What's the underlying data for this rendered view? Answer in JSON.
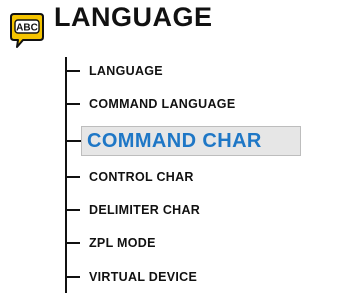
{
  "header": {
    "title": "LANGUAGE",
    "icon": "abc-speech-bubble-icon",
    "icon_text": "ABC",
    "icon_color": "#f5c400",
    "icon_ink": "#111111"
  },
  "accent_color": "#1e77c6",
  "menu": {
    "items": [
      {
        "label": "LANGUAGE",
        "selected": false
      },
      {
        "label": "COMMAND LANGUAGE",
        "selected": false
      },
      {
        "label": "COMMAND CHAR",
        "selected": true
      },
      {
        "label": "CONTROL CHAR",
        "selected": false
      },
      {
        "label": "DELIMITER CHAR",
        "selected": false
      },
      {
        "label": "ZPL MODE",
        "selected": false
      },
      {
        "label": "VIRTUAL DEVICE",
        "selected": false
      }
    ]
  }
}
